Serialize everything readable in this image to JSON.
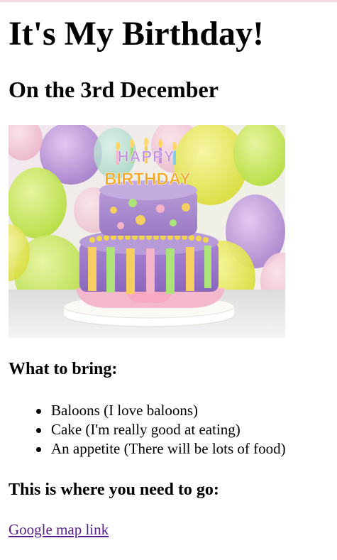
{
  "page": {
    "title": "It's My Birthday!",
    "subtitle": "On the 3rd December"
  },
  "image": {
    "cake_topper_line1": "HAPPY",
    "cake_topper_line2": "BIRTHDAY"
  },
  "bring": {
    "heading": "What to bring:",
    "items": [
      {
        "label": "Baloons (I love baloons)"
      },
      {
        "label": "Cake (I'm really good at eating)"
      },
      {
        "label": "An appetite (There will be lots of food)"
      }
    ]
  },
  "where": {
    "heading": "This is where you need to go:",
    "link_label": "Google map link"
  },
  "colors": {
    "link_visited": "#551a8b",
    "text": "#000000",
    "background": "#ffffff"
  }
}
